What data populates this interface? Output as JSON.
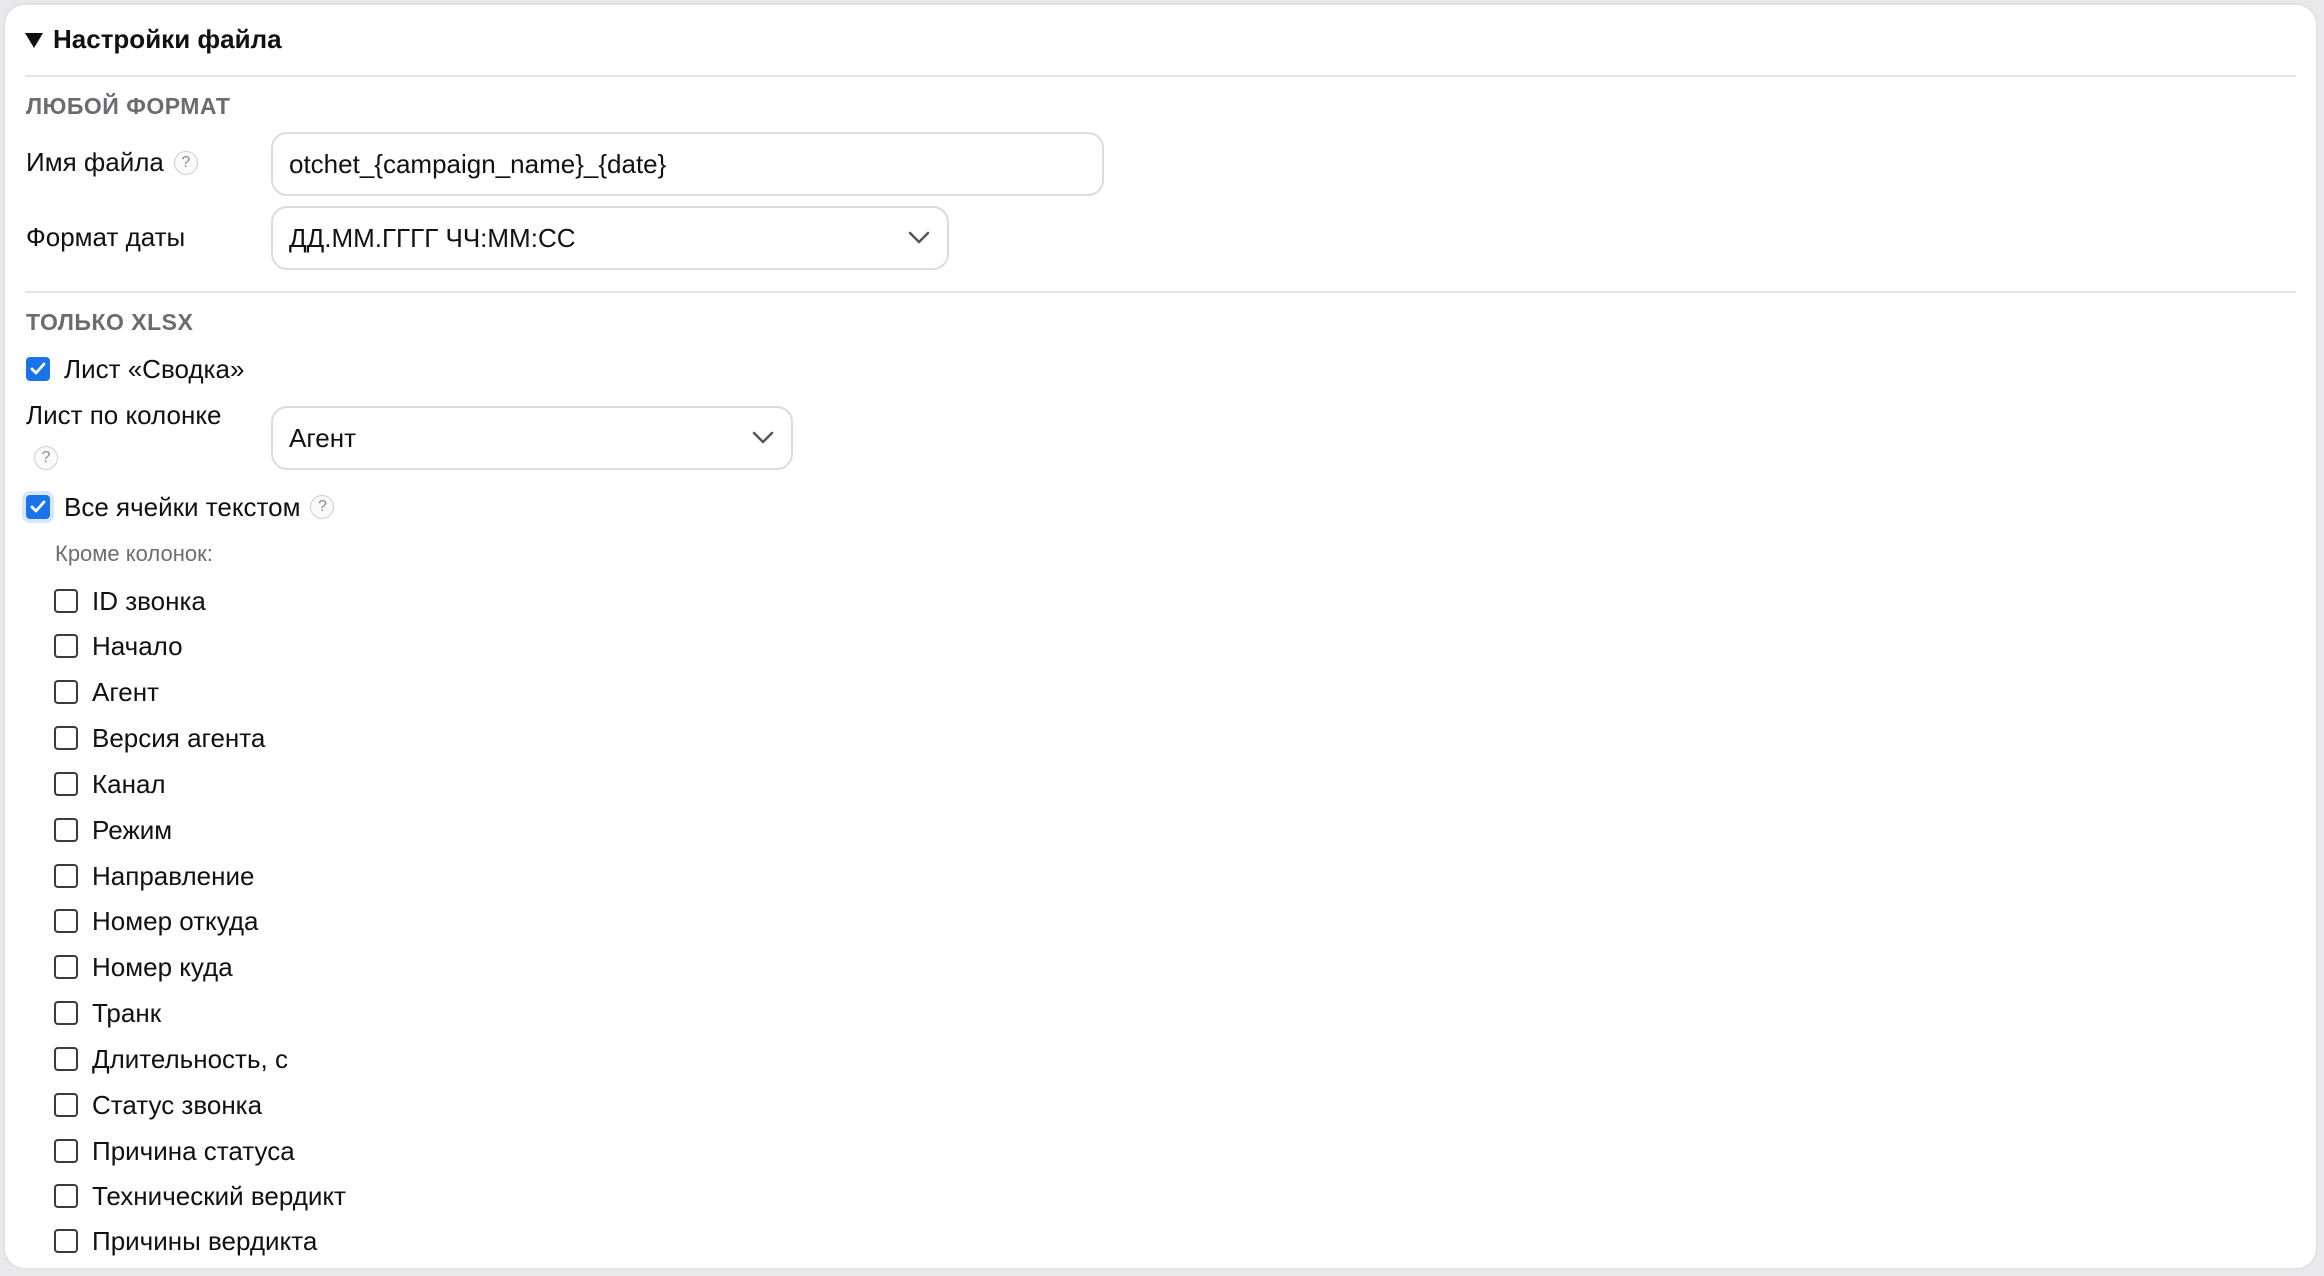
{
  "summary": {
    "label": "Настройки файла"
  },
  "sections": {
    "any_format": "ЛЮБОЙ ФОРМАТ",
    "xlsx_only": "ТОЛЬКО XLSX"
  },
  "filename": {
    "label": "Имя файла",
    "value": "otchet_{campaign_name}_{date}"
  },
  "date_format": {
    "label": "Формат даты",
    "value": "ДД.ММ.ГГГГ ЧЧ:ММ:СС"
  },
  "summary_sheet": {
    "label": "Лист «Сводка»",
    "checked": true
  },
  "sheet_by_column": {
    "label": "Лист по колонке",
    "value": "Агент"
  },
  "all_text": {
    "label": "Все ячейки текстом",
    "checked": true
  },
  "except": {
    "label": "Кроме колонок:",
    "columns": [
      "ID звонка",
      "Начало",
      "Агент",
      "Версия агента",
      "Канал",
      "Режим",
      "Направление",
      "Номер откуда",
      "Номер куда",
      "Транк",
      "Длительность, с",
      "Статус звонка",
      "Причина статуса",
      "Технический вердикт",
      "Причины вердикта"
    ]
  },
  "help_glyph": "?",
  "colors": {
    "accent": "#1a73e8",
    "border": "#dcdce0",
    "muted": "#6b6b70"
  }
}
